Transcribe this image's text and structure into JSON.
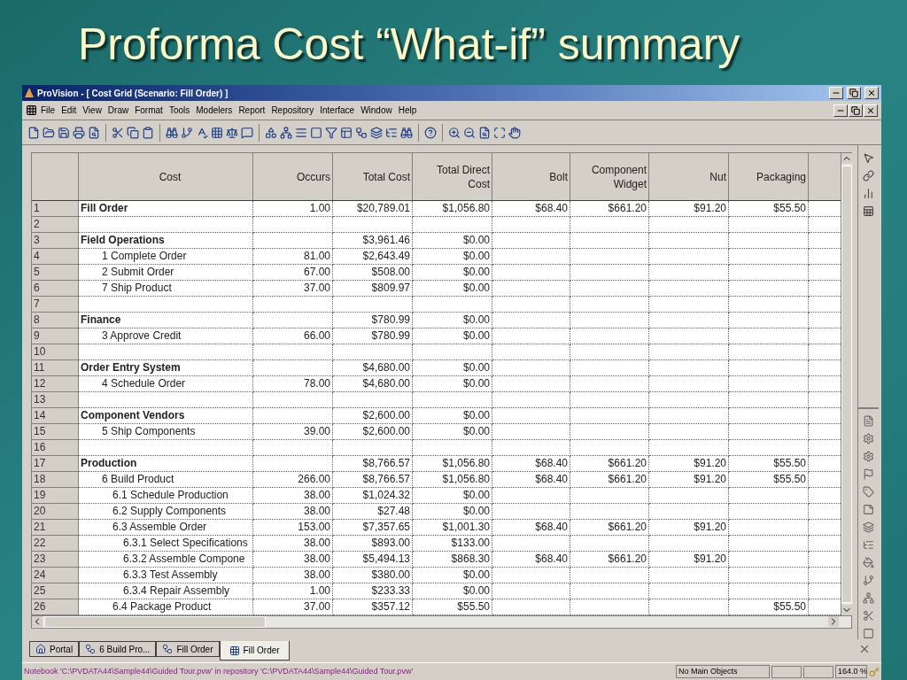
{
  "slide_title": "Proforma Cost “What-if” summary",
  "window": {
    "title": "ProVision - [ Cost Grid (Scenario: Fill Order) ]"
  },
  "menu": [
    "File",
    "Edit",
    "View",
    "Draw",
    "Format",
    "Tools",
    "Modelers",
    "Report",
    "Repository",
    "Interface",
    "Window",
    "Help"
  ],
  "table": {
    "columns": [
      {
        "label": "Cost"
      },
      {
        "label": "Occurs"
      },
      {
        "label": "Total Cost"
      },
      {
        "label": "Total Direct Cost"
      },
      {
        "label": "Bolt"
      },
      {
        "label": "Component Widget"
      },
      {
        "label": "Nut"
      },
      {
        "label": "Packaging"
      }
    ],
    "rows": [
      {
        "number": "1",
        "kind": "summary",
        "cells": [
          "Fill Order",
          "1.00",
          "$20,789.01",
          "$1,056.80",
          "$68.40",
          "$661.20",
          "$91.20",
          "$55.50"
        ]
      },
      {
        "number": "2"
      },
      {
        "number": "3",
        "kind": "summary",
        "cells": [
          "Field Operations",
          null,
          "$3,961.46",
          "$0.00"
        ],
        "children": [
          {
            "number": "4",
            "kind": "activity",
            "cells": [
              "1 Complete Order",
              "81.00",
              "$2,643.49",
              "$0.00"
            ]
          },
          {
            "number": "5",
            "kind": "activity",
            "cells": [
              "2 Submit Order",
              "67.00",
              "$508.00",
              "$0.00"
            ]
          },
          {
            "number": "6",
            "kind": "activity",
            "cells": [
              "7 Ship Product",
              "37.00",
              "$809.97",
              "$0.00"
            ]
          }
        ]
      },
      {
        "number": "7"
      },
      {
        "number": "8",
        "kind": "summary",
        "cells": [
          "Finance",
          null,
          "$780.99",
          "$0.00"
        ],
        "children": [
          {
            "number": "9",
            "kind": "activity",
            "cells": [
              "3 Approve Credit",
              "66.00",
              "$780.99",
              "$0.00"
            ]
          }
        ]
      },
      {
        "number": "10"
      },
      {
        "number": "11",
        "kind": "summary",
        "cells": [
          "Order Entry System",
          null,
          "$4,680.00",
          "$0.00"
        ],
        "children": [
          {
            "number": "12",
            "kind": "activity",
            "cells": [
              "4 Schedule Order",
              "78.00",
              "$4,680.00",
              "$0.00"
            ]
          }
        ]
      },
      {
        "number": "13"
      },
      {
        "number": "14",
        "kind": "summary",
        "cells": [
          "Component Vendors",
          null,
          "$2,600.00",
          "$0.00"
        ],
        "children": [
          {
            "number": "15",
            "kind": "activity",
            "cells": [
              "5 Ship Components",
              "39.00",
              "$2,600.00",
              "$0.00"
            ]
          }
        ]
      },
      {
        "number": "16"
      },
      {
        "number": "17",
        "kind": "summary",
        "cells": [
          "Production",
          null,
          "$8,766.57",
          "$1,056.80",
          "$68.40",
          "$661.20",
          "$91.20",
          "$55.50"
        ],
        "children": [
          {
            "number": "18",
            "kind": "activity",
            "cells": [
              "6 Build Product",
              "266.00",
              "$8,766.57",
              "$1,056.80",
              "$68.40",
              "$661.20",
              "$91.20",
              "$55.50"
            ],
            "children": [
              {
                "number": "19",
                "kind": "activity",
                "cells": [
                  "6.1 Schedule Production",
                  "38.00",
                  "$1,024.32",
                  "$0.00"
                ]
              },
              {
                "number": "20",
                "kind": "activity",
                "cells": [
                  "6.2 Supply Components",
                  "38.00",
                  "$27.48",
                  "$0.00"
                ]
              },
              {
                "number": "21",
                "kind": "activity",
                "cells": [
                  "6.3 Assemble Order",
                  "153.00",
                  "$7,357.65",
                  "$1,001.30",
                  "$68.40",
                  "$661.20",
                  "$91.20"
                ],
                "children": [
                  {
                    "number": "22",
                    "kind": "activity",
                    "cells": [
                      "6.3.1 Select Specifications",
                      "38.00",
                      "$893.00",
                      "$133.00"
                    ]
                  },
                  {
                    "number": "23",
                    "kind": "activity",
                    "cells": [
                      "6.3.2 Assemble Compone",
                      "38.00",
                      "$5,494.13",
                      "$868.30",
                      "$68.40",
                      "$661.20",
                      "$91.20"
                    ]
                  },
                  {
                    "number": "24",
                    "kind": "activity",
                    "cells": [
                      "6.3.3 Test Assembly",
                      "38.00",
                      "$380.00",
                      "$0.00"
                    ]
                  },
                  {
                    "number": "25",
                    "kind": "activity",
                    "cells": [
                      "6.3.4 Repair Assembly",
                      "1.00",
                      "$233.33",
                      "$0.00"
                    ]
                  }
                ]
              },
              {
                "number": "26",
                "kind": "activity",
                "cells": [
                  "6.4 Package Product",
                  "37.00",
                  "$357.12",
                  "$55.50",
                  null,
                  null,
                  null,
                  "$55.50"
                ]
              }
            ]
          }
        ]
      }
    ]
  },
  "tabs": [
    {
      "label": "Portal",
      "kind": "portal",
      "selected": false
    },
    {
      "label": "6 Build Pro...",
      "kind": "process",
      "selected": false
    },
    {
      "label": "Fill Order",
      "kind": "process",
      "selected": false
    },
    {
      "label": "Fill Order",
      "kind": "grid",
      "selected": true
    }
  ],
  "status_bar": {
    "message": "Notebook 'C:\\PVDATA44\\Sample44\\Guided Tour.pvw' in repository 'C:\\PVDATA44\\Sample44\\Guided Tour.pvw'",
    "objects": "No Main Objects",
    "zoom": "164.0 %"
  }
}
